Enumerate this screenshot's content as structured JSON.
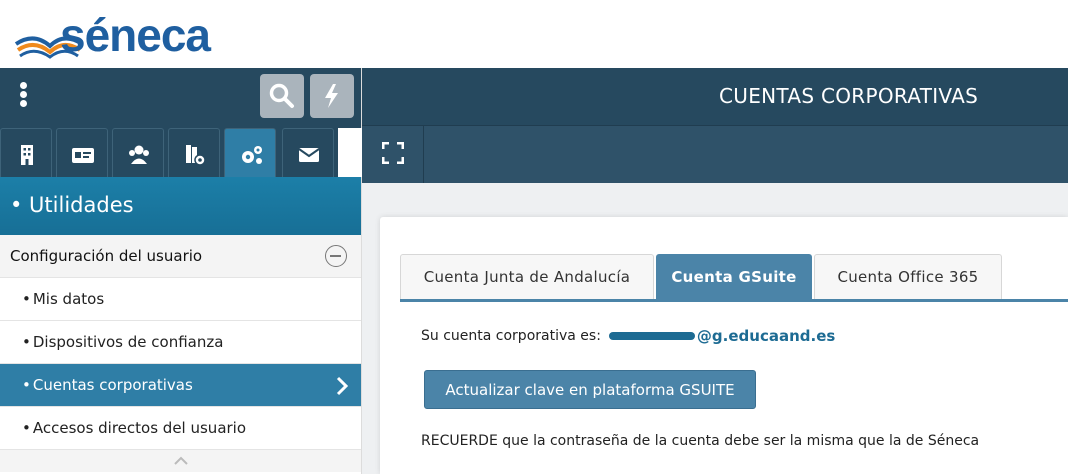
{
  "brand": {
    "name": "séneca"
  },
  "sidebar": {
    "section_title": "• Utilidades",
    "group_label": "Configuración del usuario",
    "items": [
      {
        "label": "Mis datos"
      },
      {
        "label": "Dispositivos de confianza"
      },
      {
        "label": "Cuentas corporativas"
      },
      {
        "label": "Accesos directos del usuario"
      }
    ]
  },
  "main": {
    "title": "CUENTAS CORPORATIVAS",
    "tabs": [
      {
        "label": "Cuenta Junta de Andalucía"
      },
      {
        "label": "Cuenta GSuite"
      },
      {
        "label": "Cuenta Office 365"
      }
    ],
    "account_label": "Su cuenta corporativa es:",
    "email_domain": "@g.educaand.es",
    "update_button": "Actualizar clave en plataforma GSUITE",
    "note": "RECUERDE que la contraseña de la cuenta debe ser la misma que la de Séneca"
  },
  "colors": {
    "header": "#26495f",
    "accent": "#2f7ea6",
    "tab_active": "#4b84a8"
  }
}
